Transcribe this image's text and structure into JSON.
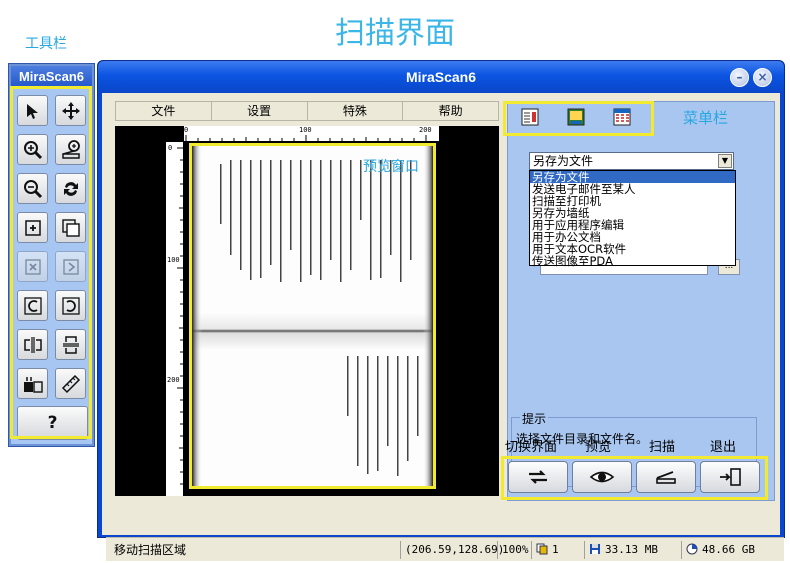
{
  "annotations": {
    "page_title": "扫描界面",
    "toolbar": "工具栏",
    "menu": "菜单栏",
    "preview": "预览窗口"
  },
  "toolbar": {
    "title": "MiraScan6",
    "help_label": "?"
  },
  "window": {
    "title": "MiraScan6",
    "minimize": "–",
    "close": "×"
  },
  "menubar": {
    "items": [
      "文件",
      "设置",
      "特殊",
      "帮助"
    ]
  },
  "preview": {
    "ruler_h": [
      "0",
      "100",
      "200"
    ],
    "ruler_v": [
      "0",
      "100",
      "200"
    ]
  },
  "panel": {
    "selected": "另存为文件",
    "options": [
      "另存为文件",
      "发送电子邮件至某人",
      "扫描至打印机",
      "另存为墙纸",
      "用于应用程序编辑",
      "用于办公文档",
      "用于文本OCR软件",
      "传送图像至PDA"
    ],
    "tip_legend": "提示",
    "tip_text": "选择文件目录和文件名。"
  },
  "actions": {
    "switch": "切换界面",
    "preview": "预览",
    "scan": "扫描",
    "exit": "退出"
  },
  "statusbar": {
    "message": "移动扫描区域",
    "coords": "(206.59,128.69)",
    "zoom": "100%",
    "pages": "1",
    "memory": "33.13 MB",
    "disk": "48.66 GB"
  }
}
